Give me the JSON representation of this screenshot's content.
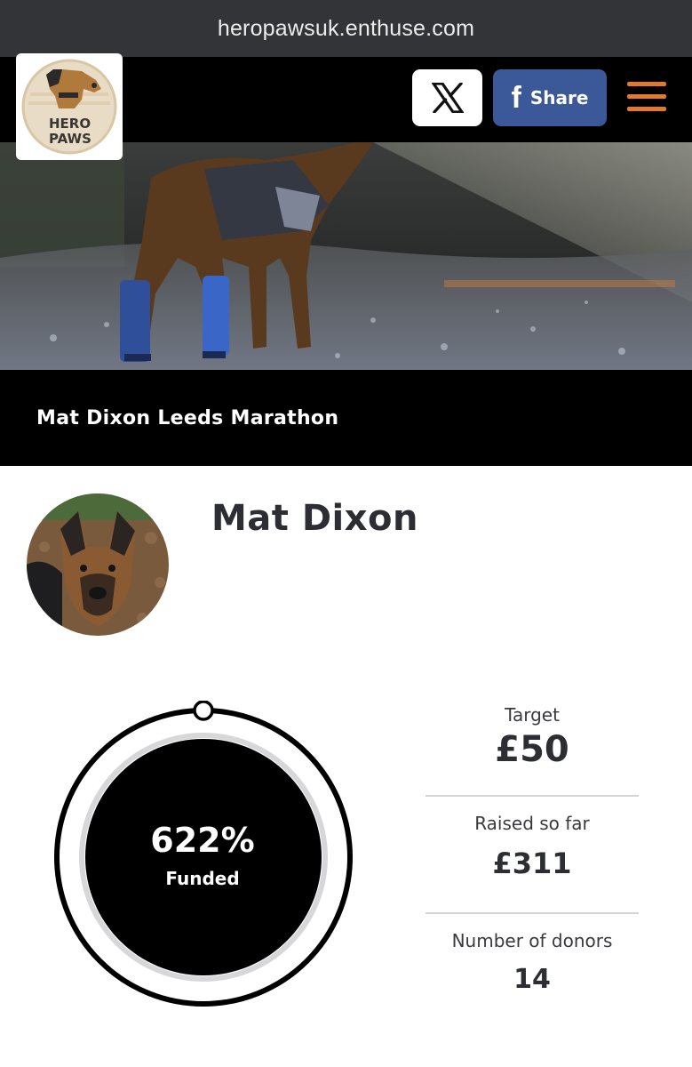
{
  "browser": {
    "url": "heropawsuk.enthuse.com"
  },
  "header": {
    "logo_text_line1": "HERO",
    "logo_text_line2": "PAWS",
    "twitter_icon": "x-logo-icon",
    "share_icon": "facebook-f-icon",
    "share_label": "Share",
    "menu_icon": "hamburger-menu-icon",
    "menu_color": "#e07a2f",
    "facebook_color": "#3b5998"
  },
  "page": {
    "title": "Mat Dixon Leeds Marathon",
    "fundraiser_name": "Mat Dixon"
  },
  "progress": {
    "funded_percent": "622%",
    "funded_label": "Funded",
    "ring_fraction": 1.0
  },
  "stats": {
    "target_label": "Target",
    "target_value": "£50",
    "raised_label": "Raised so far",
    "raised_value": "£311",
    "donors_label": "Number of donors",
    "donors_value": "14"
  }
}
